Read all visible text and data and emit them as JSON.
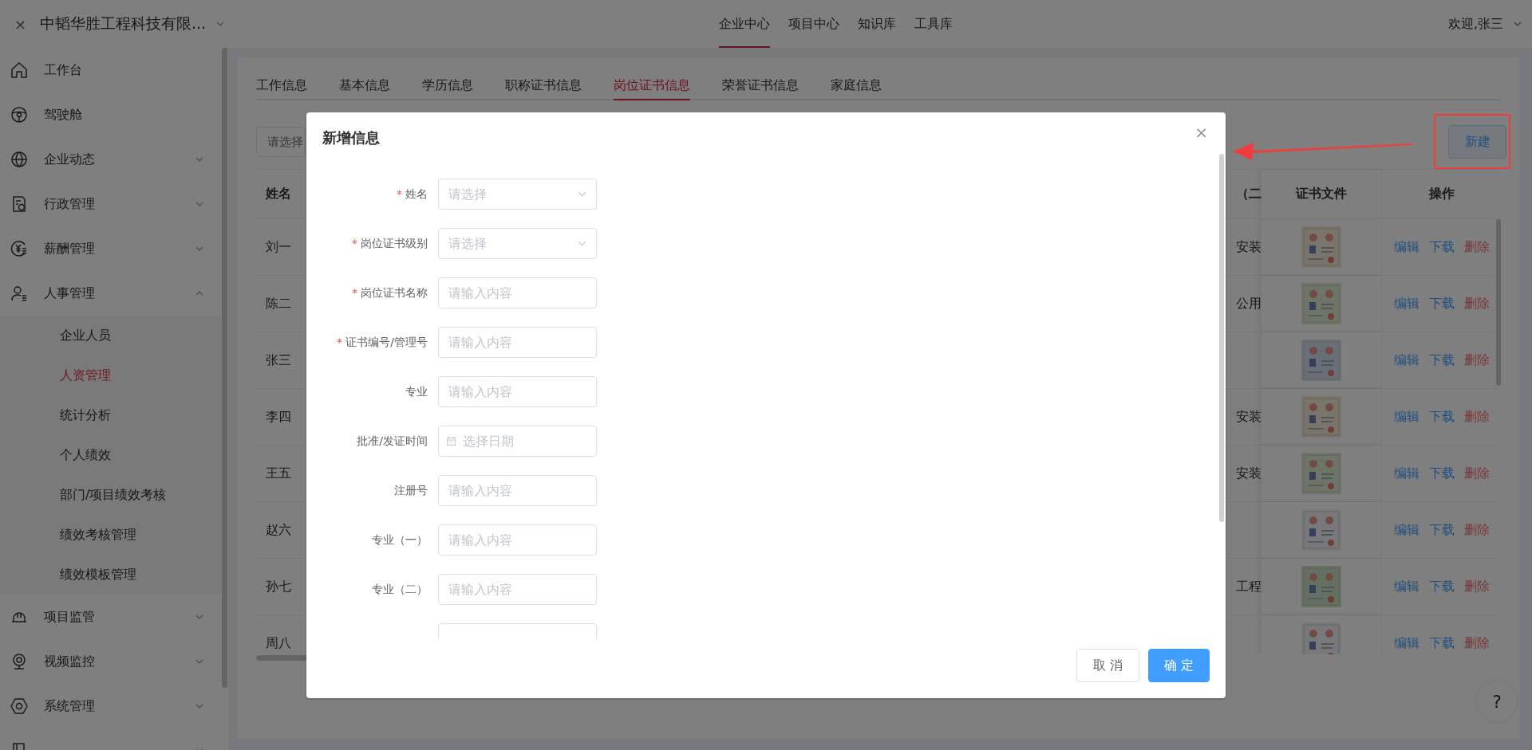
{
  "top_bar": {
    "close": "×",
    "company": "中韬华胜工程科技有限...",
    "nav": [
      {
        "label": "企业中心",
        "selected": true
      },
      {
        "label": "项目中心",
        "selected": false
      },
      {
        "label": "知识库",
        "selected": false
      },
      {
        "label": "工具库",
        "selected": false
      }
    ],
    "user": "欢迎,张三"
  },
  "sidebar": {
    "items": [
      {
        "label": "工作台"
      },
      {
        "label": "驾驶舱"
      },
      {
        "label": "企业动态",
        "expanded": false
      },
      {
        "label": "行政管理",
        "expanded": false
      },
      {
        "label": "薪酬管理",
        "expanded": false
      },
      {
        "label": "人事管理",
        "expanded": true,
        "children": [
          {
            "label": "企业人员",
            "selected": false
          },
          {
            "label": "人资管理",
            "selected": true
          },
          {
            "label": "统计分析",
            "selected": false
          },
          {
            "label": "个人绩效",
            "selected": false
          },
          {
            "label": "部门/项目绩效考核",
            "selected": false
          },
          {
            "label": "绩效考核管理",
            "selected": false
          },
          {
            "label": "绩效模板管理",
            "selected": false
          }
        ]
      },
      {
        "label": "项目监管",
        "expanded": false
      },
      {
        "label": "视频监控",
        "expanded": false
      },
      {
        "label": "系统管理",
        "expanded": false
      },
      {
        "expanded": false
      }
    ]
  },
  "tabs": [
    {
      "label": "工作信息",
      "selected": false
    },
    {
      "label": "基本信息",
      "selected": false
    },
    {
      "label": "学历信息",
      "selected": false
    },
    {
      "label": "职称证书信息",
      "selected": false
    },
    {
      "label": "岗位证书信息",
      "selected": true
    },
    {
      "label": "荣誉证书信息",
      "selected": false
    },
    {
      "label": "家庭信息",
      "selected": false
    }
  ],
  "toolbar": {
    "filter_placeholder": "请选择",
    "new_button": "新建"
  },
  "table": {
    "columns": [
      "姓名",
      "（二",
      "证书文件",
      "操作"
    ],
    "rows": [
      {
        "name": "刘一",
        "column_2": "安装",
        "certificate": {
          "kind": "picture"
        },
        "actions": [
          {
            "label": "编辑",
            "kind": "link"
          },
          {
            "label": "下载",
            "kind": "link"
          },
          {
            "label": "删除",
            "kind": "danger"
          }
        ]
      },
      {
        "name": "陈二",
        "column_2": "公用",
        "certificate": {
          "kind": "picture"
        },
        "actions": [
          {
            "label": "编辑",
            "kind": "link"
          },
          {
            "label": "下载",
            "kind": "link"
          },
          {
            "label": "删除",
            "kind": "danger"
          }
        ]
      },
      {
        "name": "张三",
        "certificate": {
          "kind": "picture"
        },
        "actions": [
          {
            "label": "编辑",
            "kind": "link"
          },
          {
            "label": "下载",
            "kind": "link"
          },
          {
            "label": "删除",
            "kind": "danger"
          }
        ]
      },
      {
        "name": "李四",
        "column_2": "安装",
        "certificate": {
          "kind": "picture"
        },
        "actions": [
          {
            "label": "编辑",
            "kind": "link"
          },
          {
            "label": "下载",
            "kind": "link"
          },
          {
            "label": "删除",
            "kind": "danger"
          }
        ]
      },
      {
        "name": "王五",
        "column_2": "安装",
        "certificate": {
          "kind": "picture"
        },
        "actions": [
          {
            "label": "编辑",
            "kind": "link"
          },
          {
            "label": "下载",
            "kind": "link"
          },
          {
            "label": "删除",
            "kind": "danger"
          }
        ]
      },
      {
        "name": "赵六",
        "certificate": {
          "kind": "picture"
        },
        "actions": [
          {
            "label": "编辑",
            "kind": "link"
          },
          {
            "label": "下载",
            "kind": "link"
          },
          {
            "label": "删除",
            "kind": "danger"
          }
        ]
      },
      {
        "name": "孙七",
        "column_2": "工程",
        "certificate": {
          "kind": "picture"
        },
        "actions": [
          {
            "label": "编辑",
            "kind": "link"
          },
          {
            "label": "下载",
            "kind": "link"
          },
          {
            "label": "删除",
            "kind": "danger"
          }
        ]
      },
      {
        "name": "周八",
        "certificate": {
          "kind": "picture"
        },
        "actions": [
          {
            "label": "编辑",
            "kind": "link"
          },
          {
            "label": "下载",
            "kind": "link"
          },
          {
            "label": "删除",
            "kind": "danger"
          }
        ]
      }
    ]
  },
  "help": "?",
  "modal": {
    "title": "新增信息",
    "close": "×",
    "fields": [
      {
        "label": "姓名",
        "required": true,
        "kind": "select",
        "placeholder": "请选择"
      },
      {
        "label": "岗位证书级别",
        "required": true,
        "kind": "select",
        "placeholder": "请选择"
      },
      {
        "label": "岗位证书名称",
        "required": true,
        "kind": "input",
        "placeholder": "请输入内容"
      },
      {
        "label": "证书编号/管理号",
        "required": true,
        "kind": "input",
        "placeholder": "请输入内容"
      },
      {
        "label": "专业",
        "required": false,
        "kind": "input",
        "placeholder": "请输入内容"
      },
      {
        "label": "批准/发证时间",
        "required": false,
        "kind": "date",
        "placeholder": "选择日期"
      },
      {
        "label": "注册号",
        "required": false,
        "kind": "input",
        "placeholder": "请输入内容"
      },
      {
        "label": "专业（一）",
        "required": false,
        "kind": "input",
        "placeholder": "请输入内容"
      },
      {
        "label": "专业（二）",
        "required": false,
        "kind": "input",
        "placeholder": "请输入内容"
      }
    ],
    "buttons": [
      {
        "label": "取 消",
        "kind": "default"
      },
      {
        "label": "确 定",
        "kind": "primary"
      }
    ]
  }
}
